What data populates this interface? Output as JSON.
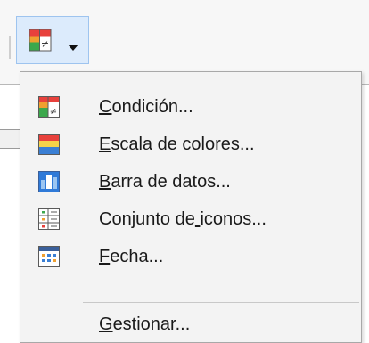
{
  "toolbar": {
    "button_icon": "conditional-format-icon",
    "caret_icon": "chevron-down-icon"
  },
  "menu": {
    "items": [
      {
        "label": "Condición...",
        "mnemonic_index": 0,
        "icon": "condition-icon"
      },
      {
        "label": "Escala de colores...",
        "mnemonic_index": 0,
        "icon": "color-scale-icon"
      },
      {
        "label": "Barra de datos...",
        "mnemonic_index": 0,
        "icon": "data-bar-icon"
      },
      {
        "label": "Conjunto de iconos...",
        "mnemonic_index": 11,
        "icon": "icon-set-icon"
      },
      {
        "label": "Fecha...",
        "mnemonic_index": 0,
        "icon": "date-icon"
      },
      {
        "label": "Gestionar...",
        "mnemonic_index": 0,
        "icon": ""
      }
    ]
  }
}
